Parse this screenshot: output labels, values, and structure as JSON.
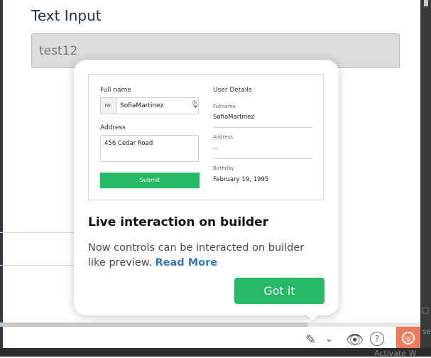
{
  "form": {
    "field_label": "Text Input",
    "text_value": "test12"
  },
  "popover": {
    "title": "Live interaction on builder",
    "description": "Now controls can be interacted on builder like preview.",
    "link_text": "Read More",
    "button_label": "Got it",
    "preview": {
      "full_name_label": "Full name",
      "prefix": "Mr.",
      "full_name_value": "SofiaMartinez",
      "address_label": "Address",
      "address_value": "456 Cedar Road",
      "submit_label": "Submit",
      "details_title": "User Details",
      "fullname_label": "Fullname",
      "fullname_value": "SofiaMartinez",
      "address_detail_label": "Address",
      "address_detail_value": "--",
      "birthday_label": "Birthday",
      "birthday_value": "February 19, 1995"
    }
  },
  "bottom_right_label": "Activate W",
  "side_label": "se",
  "progress": {
    "value": 0.73
  },
  "icons": {
    "toolbar": [
      "pencil-icon",
      "chevron-down-icon",
      "eye-icon",
      "help-icon",
      "support-icon"
    ]
  },
  "colors": {
    "accent_green": "#26b866",
    "link_blue": "#3a78b6",
    "support_orange": "#f07a5c"
  }
}
